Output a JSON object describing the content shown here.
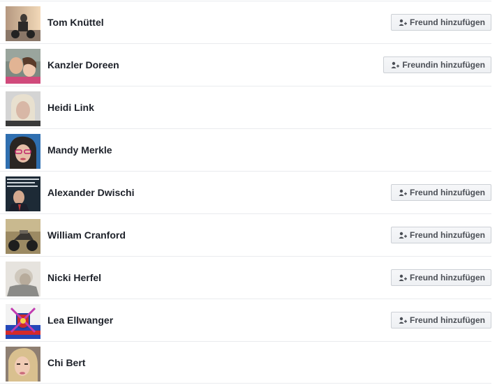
{
  "rows": [
    {
      "name": "Tom Knüttel",
      "button_label": "Freund hinzufügen",
      "avatar_icon": "person-on-motorbike-photo"
    },
    {
      "name": "Kanzler Doreen",
      "button_label": "Freundin hinzufügen",
      "avatar_icon": "family-selfie-photo"
    },
    {
      "name": "Heidi Link",
      "button_label": "",
      "avatar_icon": "blonde-woman-photo"
    },
    {
      "name": "Mandy Merkle",
      "button_label": "",
      "avatar_icon": "woman-glasses-photo"
    },
    {
      "name": "Alexander Dwischi",
      "button_label": "Freund hinzufügen",
      "avatar_icon": "man-in-suit-photo"
    },
    {
      "name": "William Cranford",
      "button_label": "Freund hinzufügen",
      "avatar_icon": "motorcycle-photo"
    },
    {
      "name": "Nicki Herfel",
      "button_label": "Freund hinzufügen",
      "avatar_icon": "faded-portrait-photo"
    },
    {
      "name": "Lea Ellwanger",
      "button_label": "Freund hinzufügen",
      "avatar_icon": "coat-of-arms-photo"
    },
    {
      "name": "Chi Bert",
      "button_label": "",
      "avatar_icon": "blonde-selfie-photo"
    }
  ],
  "colors": {
    "name_text": "#1d2129",
    "button_text": "#4b4f56",
    "button_border": "#ccd0d5",
    "divider": "#e9ebee"
  }
}
